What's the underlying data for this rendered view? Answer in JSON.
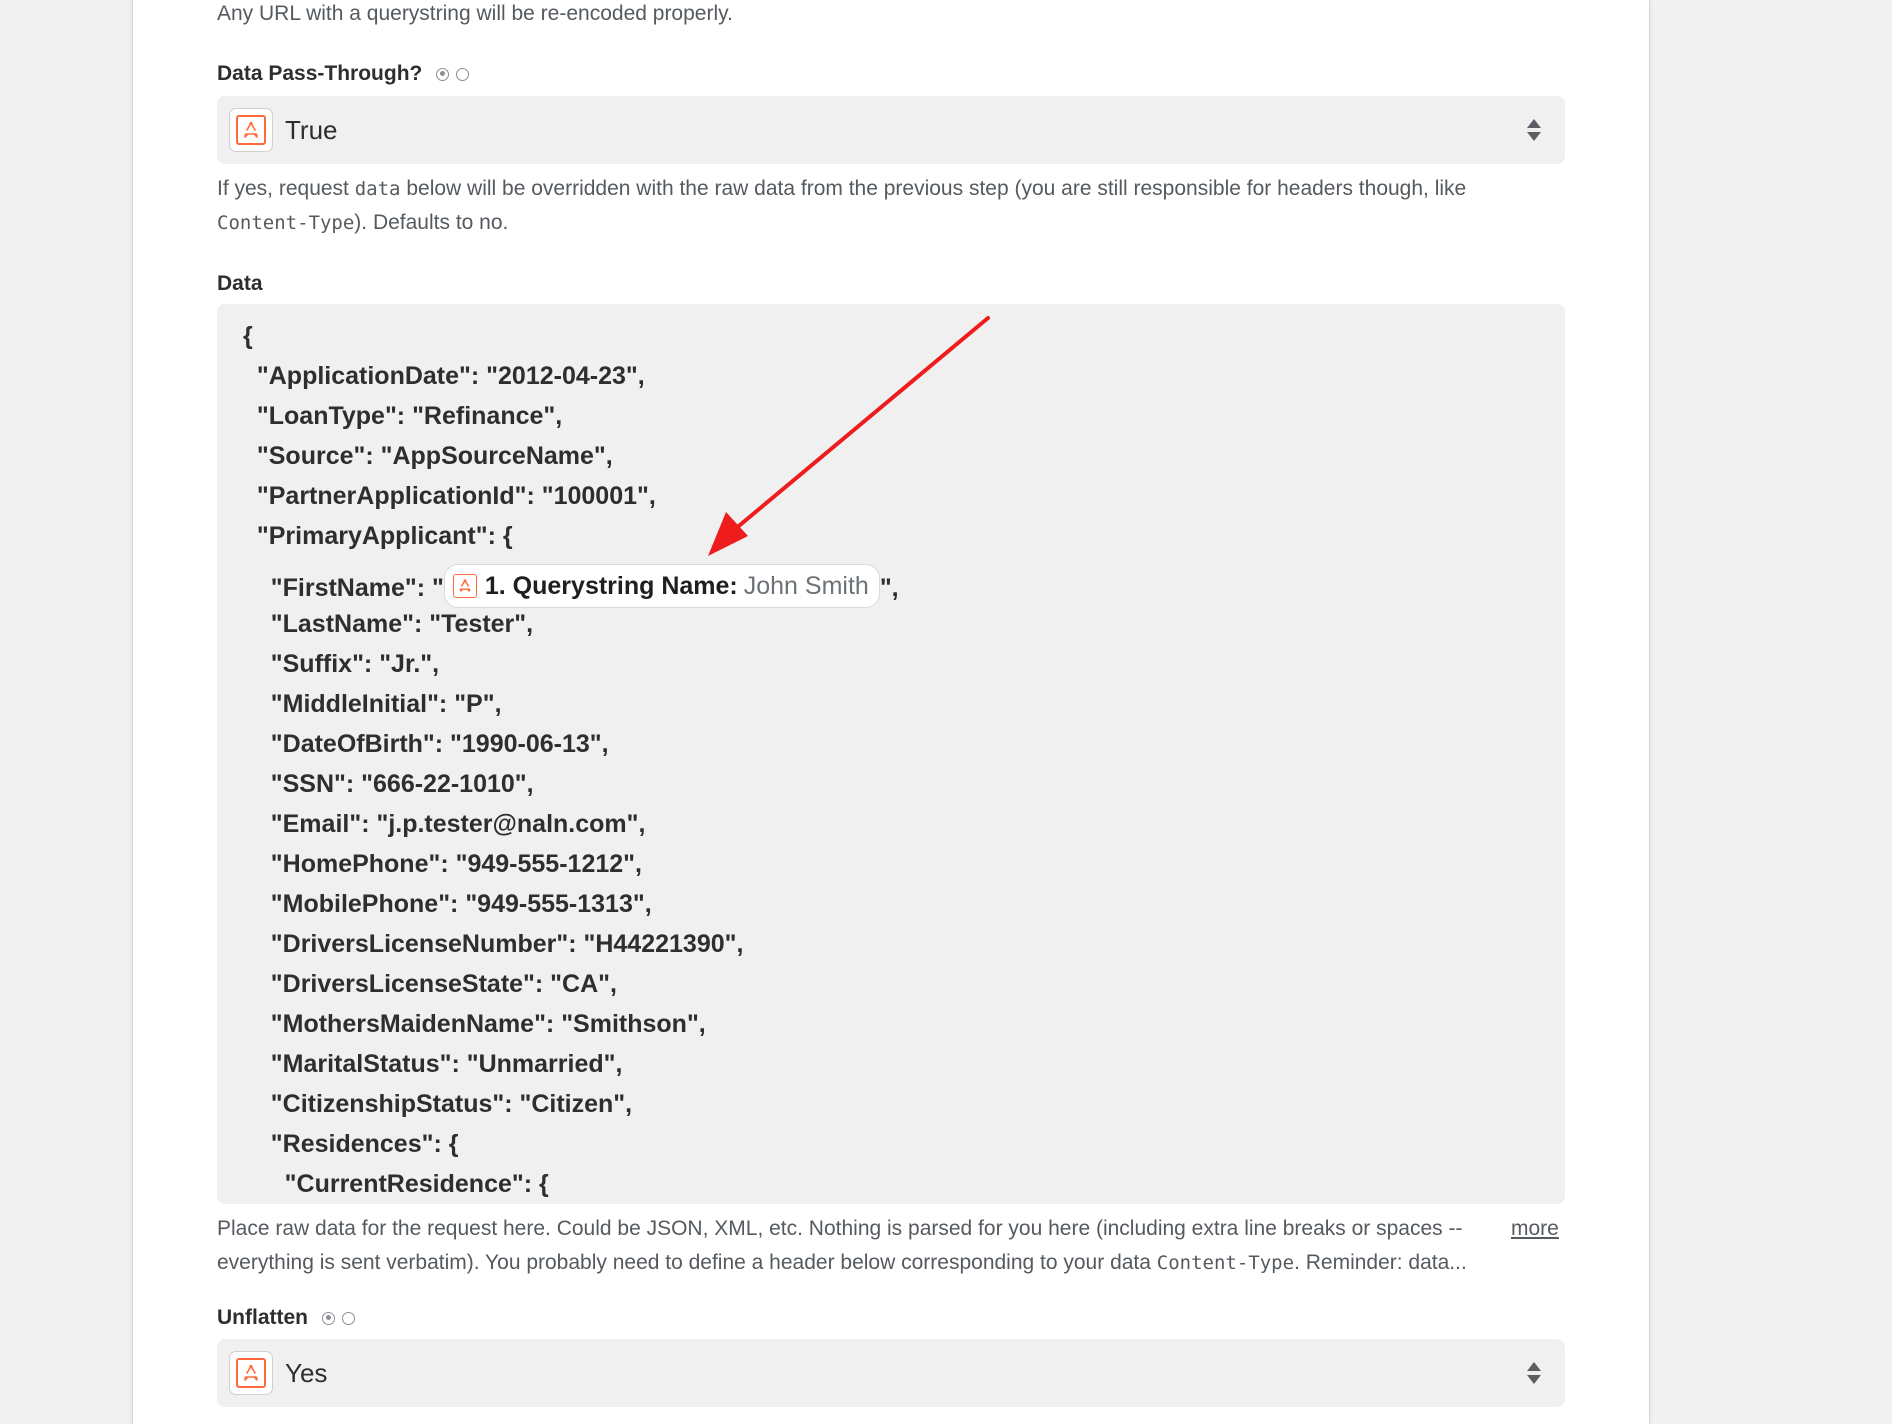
{
  "url_help": "Any URL with a querystring will be re-encoded properly.",
  "pass_through": {
    "label": "Data Pass-Through?",
    "value": "True",
    "help_part1": "If yes, request ",
    "help_code1": "data",
    "help_part2": " below will be overridden with the raw data from the previous step (you are still responsible for headers though, like",
    "help_code2": "Content-Type",
    "help_part3": "). Defaults to no."
  },
  "data_field": {
    "label": "Data",
    "lines": [
      "{",
      "  \"ApplicationDate\": \"2012-04-23\",",
      "  \"LoanType\": \"Refinance\",",
      "  \"Source\": \"AppSourceName\",",
      "  \"PartnerApplicationId\": \"100001\",",
      "  \"PrimaryApplicant\": {",
      "    \"FirstName\": \"",
      "    \"LastName\": \"Tester\",",
      "    \"Suffix\": \"Jr.\",",
      "    \"MiddleInitial\": \"P\",",
      "    \"DateOfBirth\": \"1990-06-13\",",
      "    \"SSN\": \"666-22-1010\",",
      "    \"Email\": \"j.p.tester@naln.com\",",
      "    \"HomePhone\": \"949-555-1212\",",
      "    \"MobilePhone\": \"949-555-1313\",",
      "    \"DriversLicenseNumber\": \"H44221390\",",
      "    \"DriversLicenseState\": \"CA\",",
      "    \"MothersMaidenName\": \"Smithson\",",
      "    \"MaritalStatus\": \"Unmarried\",",
      "    \"CitizenshipStatus\": \"Citizen\",",
      "    \"Residences\": {",
      "      \"CurrentResidence\": {"
    ],
    "pill_key": "1. Querystring Name:",
    "pill_value": "John Smith",
    "after_pill": "\",",
    "help_line1": "Place raw data for the request here. Could be JSON, XML, etc. Nothing is parsed for you here (including extra line breaks or spaces --",
    "help_line2a": "everything is sent verbatim). You probably need to define a header below corresponding to your data ",
    "help_code": "Content-Type",
    "help_line2b": ". Reminder: data...",
    "more": "more"
  },
  "unflatten": {
    "label": "Unflatten",
    "value": "Yes"
  },
  "colors": {
    "accent": "#ff6a3d",
    "annotation_arrow": "#ee1c1c"
  },
  "icons": [
    "webhook-app-icon",
    "select-stepper-icon",
    "annotation-arrow"
  ]
}
